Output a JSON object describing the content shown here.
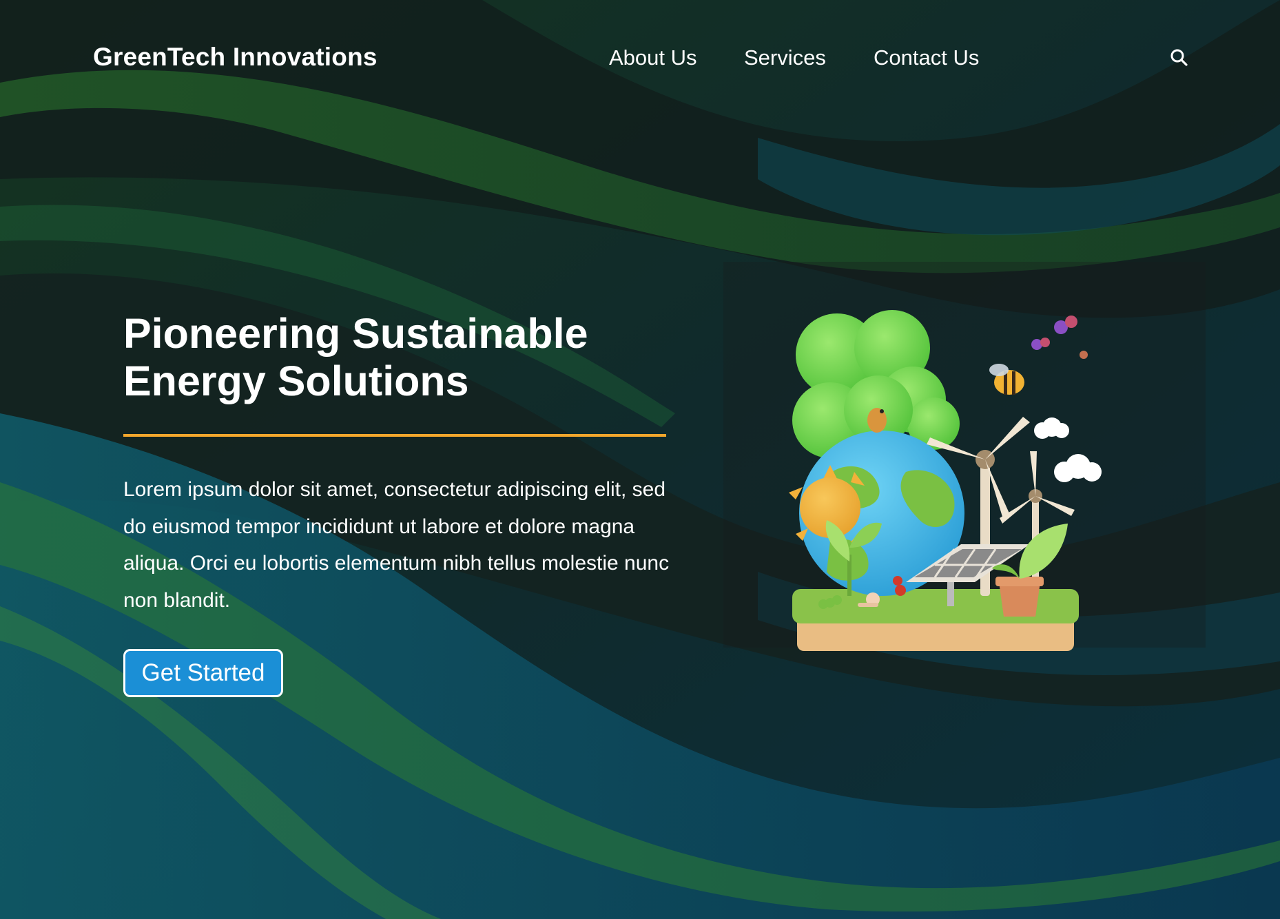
{
  "header": {
    "brand": "GreenTech Innovations",
    "nav": [
      {
        "label": "About Us"
      },
      {
        "label": "Services"
      },
      {
        "label": "Contact Us"
      }
    ],
    "search_icon": "search-icon"
  },
  "hero": {
    "title": "Pioneering Sustainable Energy Solutions",
    "body": "Lorem ipsum dolor sit amet, consectetur adipiscing elit, sed do eiusmod tempor incididunt ut labore et dolore magna aliqua. Orci eu lobortis elementum nibh tellus molestie nunc non blandit.",
    "cta_label": "Get Started"
  },
  "colors": {
    "accent_line": "#f2a62c",
    "cta_background": "#1b8fd6",
    "background_dark": "#141c1e",
    "background_green": "#1f5a2e",
    "background_teal": "#0d3d4a"
  }
}
